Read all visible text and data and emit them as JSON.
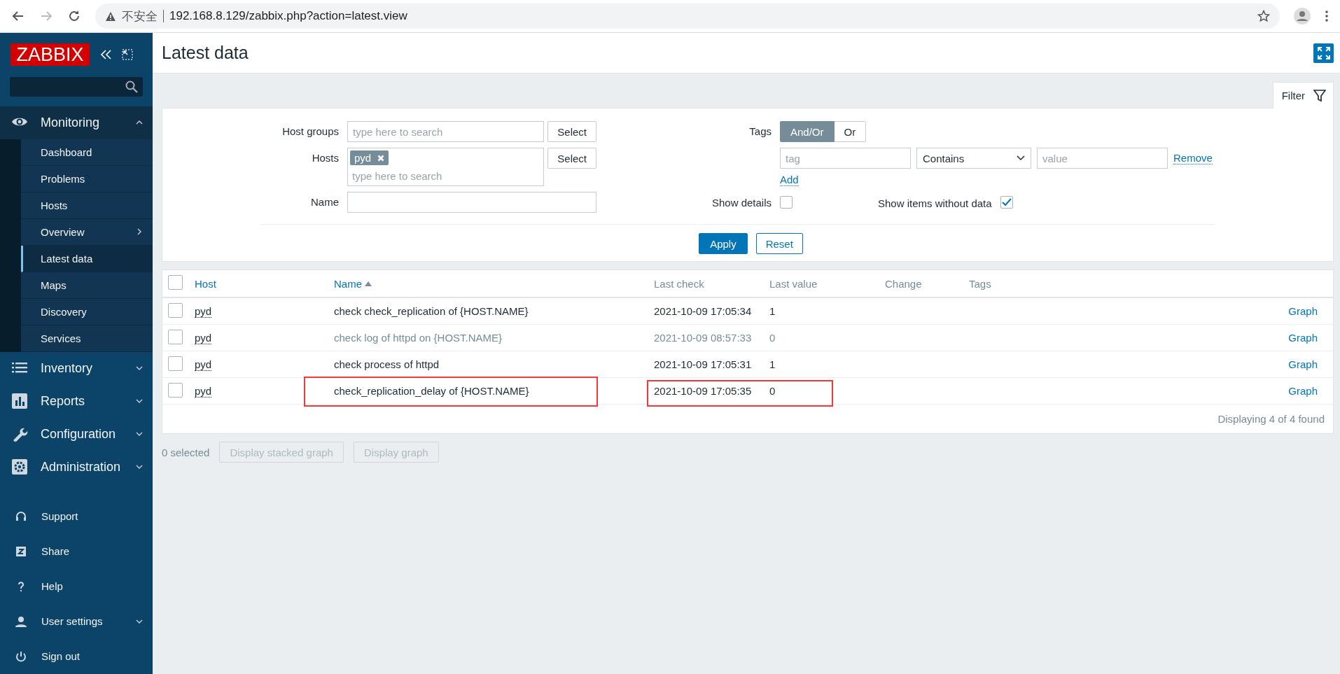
{
  "browser": {
    "security_label": "不安全",
    "url": "192.168.8.129/zabbix.php?action=latest.view"
  },
  "sidebar": {
    "logo": "ZABBIX",
    "menu": [
      {
        "label": "Monitoring",
        "expanded": true,
        "children": [
          {
            "label": "Dashboard",
            "selected": false,
            "has_submenu": false
          },
          {
            "label": "Problems",
            "selected": false,
            "has_submenu": false
          },
          {
            "label": "Hosts",
            "selected": false,
            "has_submenu": false
          },
          {
            "label": "Overview",
            "selected": false,
            "has_submenu": true
          },
          {
            "label": "Latest data",
            "selected": true,
            "has_submenu": false
          },
          {
            "label": "Maps",
            "selected": false,
            "has_submenu": false
          },
          {
            "label": "Discovery",
            "selected": false,
            "has_submenu": false
          },
          {
            "label": "Services",
            "selected": false,
            "has_submenu": false
          }
        ]
      },
      {
        "label": "Inventory",
        "expanded": false
      },
      {
        "label": "Reports",
        "expanded": false
      },
      {
        "label": "Configuration",
        "expanded": false
      },
      {
        "label": "Administration",
        "expanded": false
      }
    ],
    "bottom": [
      {
        "label": "Support",
        "has_caret": false
      },
      {
        "label": "Share",
        "has_caret": false
      },
      {
        "label": "Help",
        "has_caret": false
      },
      {
        "label": "User settings",
        "has_caret": true
      },
      {
        "label": "Sign out",
        "has_caret": false
      }
    ]
  },
  "page": {
    "title": "Latest data"
  },
  "filter": {
    "tab_label": "Filter",
    "host_groups": {
      "label": "Host groups",
      "placeholder": "type here to search",
      "button": "Select"
    },
    "hosts": {
      "label": "Hosts",
      "chips": [
        "pyd"
      ],
      "placeholder": "type here to search",
      "button": "Select"
    },
    "name": {
      "label": "Name"
    },
    "tags": {
      "label": "Tags",
      "operators": [
        {
          "label": "And/Or",
          "selected": true
        },
        {
          "label": "Or",
          "selected": false
        }
      ],
      "tag_placeholder": "tag",
      "condition": "Contains",
      "value_placeholder": "value",
      "remove": "Remove",
      "add": "Add"
    },
    "show_details": {
      "label": "Show details",
      "checked": false
    },
    "show_without_data": {
      "label": "Show items without data",
      "checked": true
    },
    "apply": "Apply",
    "reset": "Reset"
  },
  "table": {
    "select_all_checked": false,
    "columns": [
      {
        "label": "Host",
        "sortable": true,
        "sorted": false
      },
      {
        "label": "Name",
        "sortable": true,
        "sorted": true
      },
      {
        "label": "Last check",
        "sortable": false,
        "sorted": false
      },
      {
        "label": "Last value",
        "sortable": false,
        "sorted": false
      },
      {
        "label": "Change",
        "sortable": false,
        "sorted": false
      },
      {
        "label": "Tags",
        "sortable": false,
        "sorted": false
      }
    ],
    "rows": [
      {
        "checked": false,
        "host": "pyd",
        "name": "check check_replication of {HOST.NAME}",
        "last_check": "2021-10-09 17:05:34",
        "last_value": "1",
        "action": "Graph",
        "dimmed": false,
        "annotated": false
      },
      {
        "checked": false,
        "host": "pyd",
        "name": "check log of httpd on {HOST.NAME}",
        "last_check": "2021-10-09 08:57:33",
        "last_value": "0",
        "action": "Graph",
        "dimmed": true,
        "annotated": false
      },
      {
        "checked": false,
        "host": "pyd",
        "name": "check process of httpd",
        "last_check": "2021-10-09 17:05:31",
        "last_value": "1",
        "action": "Graph",
        "dimmed": false,
        "annotated": false
      },
      {
        "checked": false,
        "host": "pyd",
        "name": "check_replication_delay of {HOST.NAME}",
        "last_check": "2021-10-09 17:05:35",
        "last_value": "0",
        "action": "Graph",
        "dimmed": false,
        "annotated": true
      }
    ],
    "footer": "Displaying 4 of 4 found"
  },
  "actions": {
    "selected_count": "0 selected",
    "buttons": [
      {
        "label": "Display stacked graph",
        "disabled": true
      },
      {
        "label": "Display graph",
        "disabled": true
      }
    ]
  }
}
